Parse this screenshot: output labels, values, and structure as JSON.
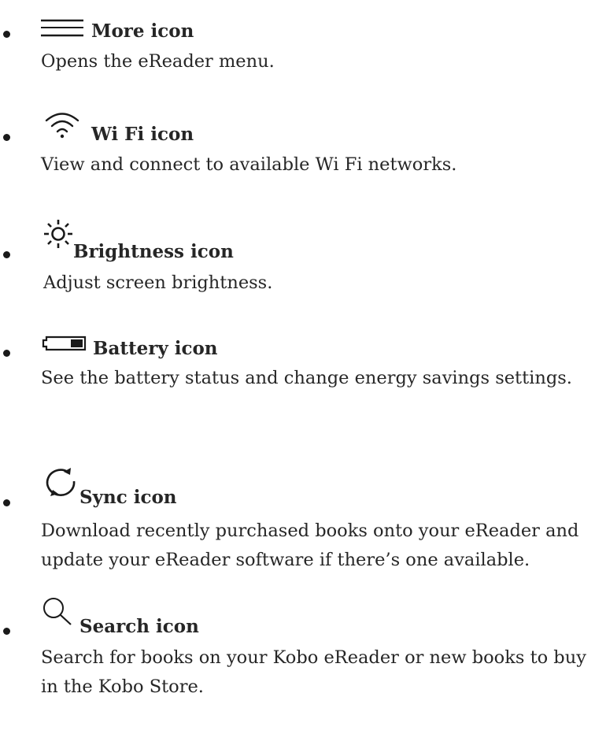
{
  "items": [
    {
      "icon": "more-icon",
      "title": "More icon",
      "desc": "Opens the eReader menu."
    },
    {
      "icon": "wifi-icon",
      "title": "Wi Fi icon",
      "desc": "View and connect to available Wi Fi networks."
    },
    {
      "icon": "brightness-icon",
      "title": "Brightness icon",
      "desc": "Adjust screen brightness."
    },
    {
      "icon": "battery-icon",
      "title": "Battery icon",
      "desc": "See the battery status and change energy savings settings."
    },
    {
      "icon": "sync-icon",
      "title": "Sync icon",
      "desc": "Download recently purchased books onto your eReader and update your eReader software if there’s one available."
    },
    {
      "icon": "search-icon",
      "title": "Search icon",
      "desc": "Search for books on your Kobo eReader or new books to buy in the Kobo Store."
    }
  ]
}
